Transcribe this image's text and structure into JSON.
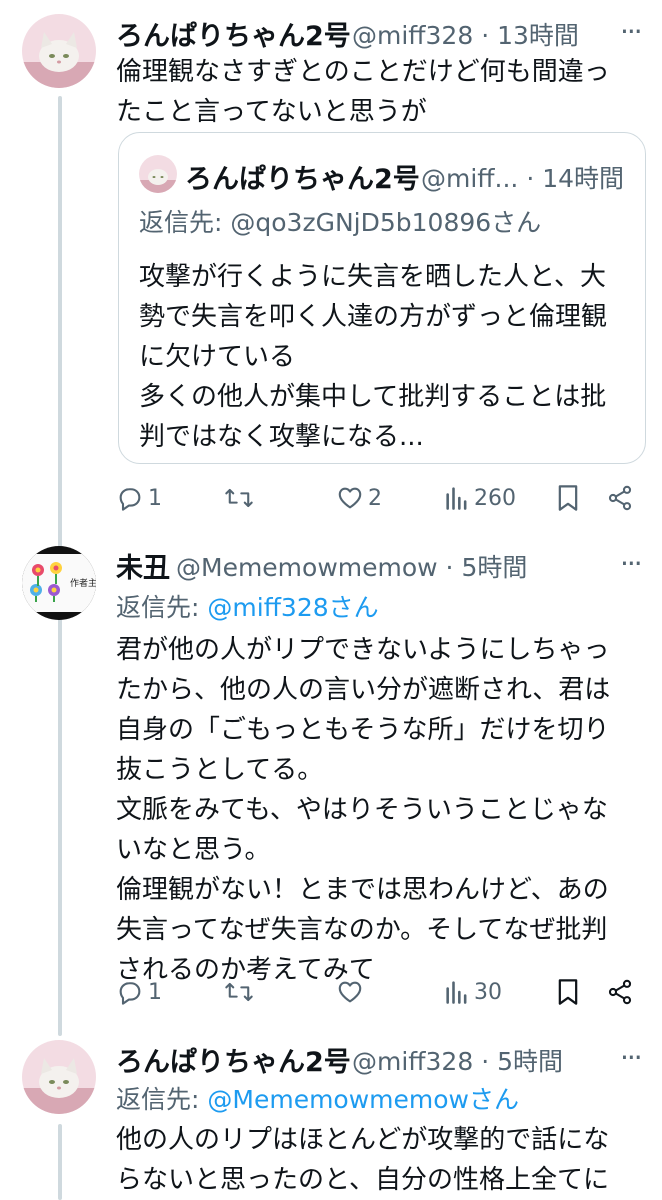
{
  "tweets": [
    {
      "author_name": "ろんぱりちゃん2号",
      "handle": "@miff328",
      "time": "13時間",
      "body_lines": [
        "倫理観なさすぎとのことだけど何も間違っ",
        "たこと言ってないと思うが"
      ],
      "quote": {
        "author_name": "ろんぱりちゃん2号",
        "handle": "@miff...",
        "time": "14時間",
        "reply_prefix": "返信先:",
        "reply_to": "@qo3zGNjD5b10896さん",
        "body_lines": [
          "攻撃が行くように失言を晒した人と、大",
          "勢で失言を叩く人達の方がずっと倫理観",
          "に欠けている",
          "多くの他人が集中して批判することは批",
          "判ではなく攻撃になる..."
        ]
      },
      "actions": {
        "replies": "1",
        "retweets": "",
        "likes": "2",
        "views": "260"
      }
    },
    {
      "author_name": "未丑",
      "handle": "@Mememowmemow",
      "time": "5時間",
      "reply_prefix": "返信先:",
      "reply_to": "@miff328さん",
      "body_lines": [
        "君が他の人がリプできないようにしちゃっ",
        "たから、他の人の言い分が遮断され、君は",
        "自身の「ごもっともそうな所」だけを切り",
        "抜こうとしてる。",
        "文脈をみても、やはりそういうことじゃな",
        "いなと思う。",
        "倫理観がない！とまでは思わんけど、あの",
        "失言ってなぜ失言なのか。そしてなぜ批判",
        "されるのか考えてみて"
      ],
      "actions": {
        "replies": "1",
        "retweets": "",
        "likes": "",
        "views": "30"
      }
    },
    {
      "author_name": "ろんぱりちゃん2号",
      "handle": "@miff328",
      "time": "5時間",
      "reply_prefix": "返信先:",
      "reply_to": "@Mememowmemowさん",
      "body_lines": [
        "他の人のリプはほとんどが攻撃的で話にな",
        "らないと思ったのと、自分の性格上全てに"
      ]
    }
  ],
  "avatar2_text": "作者主",
  "icons": [
    "reply-icon",
    "retweet-icon",
    "like-icon",
    "views-icon",
    "bookmark-icon",
    "share-icon",
    "more-icon"
  ],
  "colors": {
    "text": "#0f1419",
    "secondary": "#536471",
    "link": "#1d9bf0",
    "border": "#cfd9de",
    "avatar_pink": "#f3dce3"
  }
}
